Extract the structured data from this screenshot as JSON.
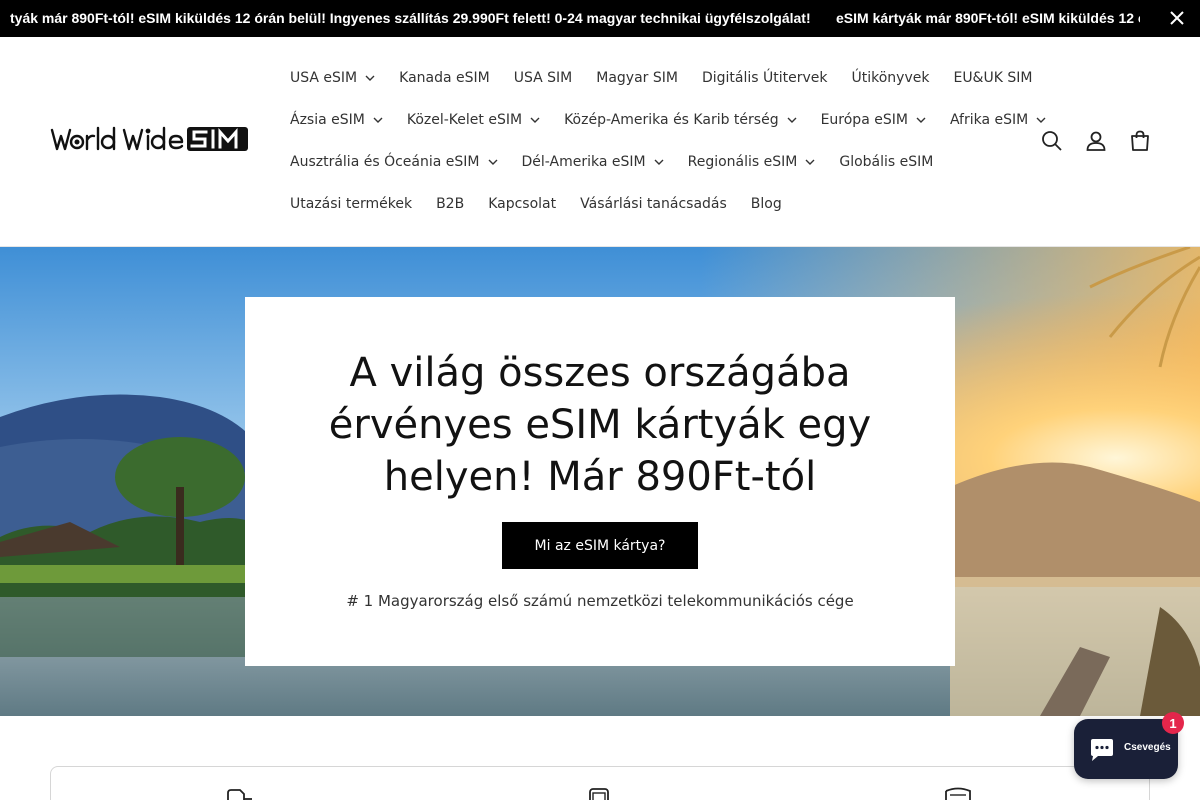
{
  "announcement": {
    "messages": [
      "tyák már 890Ft-tól! eSIM kiküldés 12 órán belül! Ingyenes szállítás 29.990Ft felett! 0-24 magyar technikai ügyfélszolgálat!",
      "eSIM kártyák már 890Ft-tól! eSIM kiküldés 12 órán belül! Ingyenes szállítás 29.990Ft felett! 0-24 magyar technikai ügyfélszolgálat!"
    ]
  },
  "header": {
    "logo_text": "World Wide SIM",
    "nav_rows": [
      [
        {
          "label": "USA eSIM",
          "dropdown": true
        },
        {
          "label": "Kanada eSIM",
          "dropdown": false
        },
        {
          "label": "USA SIM",
          "dropdown": false
        },
        {
          "label": "Magyar SIM",
          "dropdown": false
        },
        {
          "label": "Digitális Útitervek",
          "dropdown": false
        },
        {
          "label": "Útikönyvek",
          "dropdown": false
        },
        {
          "label": "EU&UK SIM",
          "dropdown": false
        }
      ],
      [
        {
          "label": "Ázsia eSIM",
          "dropdown": true
        },
        {
          "label": "Közel-Kelet eSIM",
          "dropdown": true
        },
        {
          "label": "Közép-Amerika és Karib térség",
          "dropdown": true
        },
        {
          "label": "Európa eSIM",
          "dropdown": true
        },
        {
          "label": "Afrika eSIM",
          "dropdown": true
        }
      ],
      [
        {
          "label": "Ausztrália és Óceánia eSIM",
          "dropdown": true
        },
        {
          "label": "Dél-Amerika eSIM",
          "dropdown": true
        },
        {
          "label": "Regionális eSIM",
          "dropdown": true
        },
        {
          "label": "Globális eSIM",
          "dropdown": false
        }
      ],
      [
        {
          "label": "Utazási termékek",
          "dropdown": false
        },
        {
          "label": "B2B",
          "dropdown": false
        },
        {
          "label": "Kapcsolat",
          "dropdown": false
        },
        {
          "label": "Vásárlási tanácsadás",
          "dropdown": false
        },
        {
          "label": "Blog",
          "dropdown": false
        }
      ]
    ],
    "icons": [
      "search-icon",
      "account-icon",
      "cart-icon"
    ]
  },
  "hero": {
    "title": "A világ összes országába érvényes eSIM kártyák egy helyen! Már 890Ft-tól",
    "button_label": "Mi az eSIM kártya?",
    "subtitle": "# 1 Magyarország első számú nemzetközi telekommunikációs cége"
  },
  "chat": {
    "label": "Csevegés",
    "badge_count": "1"
  },
  "colors": {
    "announcement_bg": "#000000",
    "button_bg": "#000000",
    "chat_bg": "#1a2038",
    "badge_bg": "#e4264b"
  }
}
